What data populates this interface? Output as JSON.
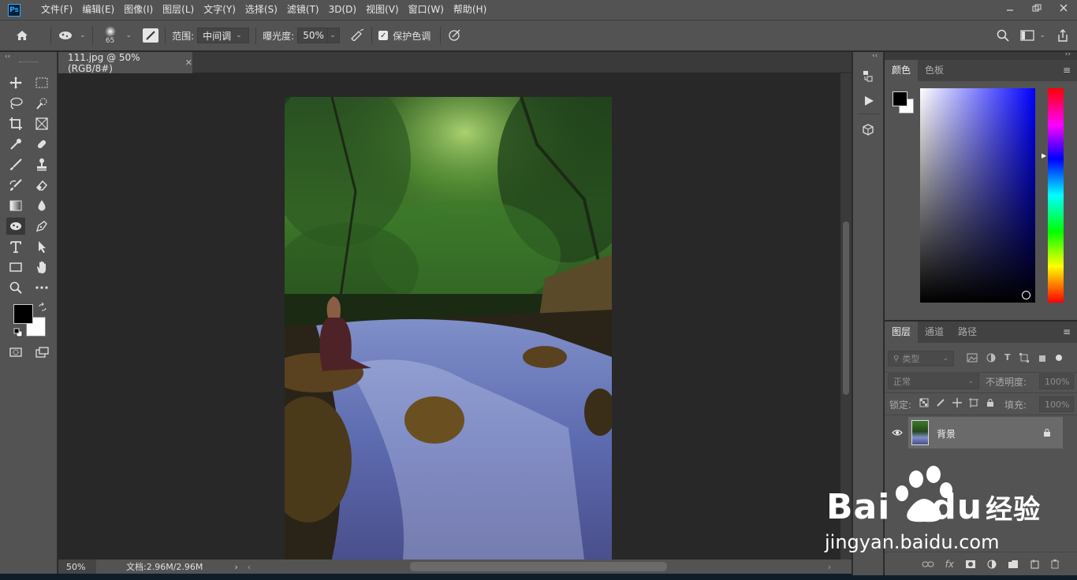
{
  "menu": {
    "logo": "Ps",
    "items": [
      "文件(F)",
      "编辑(E)",
      "图像(I)",
      "图层(L)",
      "文字(Y)",
      "选择(S)",
      "滤镜(T)",
      "3D(D)",
      "视图(V)",
      "窗口(W)",
      "帮助(H)"
    ]
  },
  "options": {
    "brush_size": "65",
    "range_label": "范围:",
    "range_value": "中间调",
    "exposure_label": "曝光度:",
    "exposure_value": "50%",
    "protect_label": "保护色调"
  },
  "document": {
    "tab_title": "111.jpg @ 50%(RGB/8#)",
    "zoom": "50%",
    "doc_size": "文档:2.96M/2.96M"
  },
  "color_panel": {
    "tabs": [
      "颜色",
      "色板"
    ]
  },
  "layers_panel": {
    "tabs": [
      "图层",
      "通道",
      "路径"
    ],
    "filter_placeholder": "类型",
    "blend_mode": "正常",
    "opacity_label": "不透明度:",
    "opacity_value": "100%",
    "lock_label": "锁定:",
    "fill_label": "填充:",
    "fill_value": "100%",
    "layers": [
      {
        "name": "背景"
      }
    ],
    "footer_fx": "fx"
  },
  "watermark": {
    "brand": "Bai",
    "brand2": "du",
    "brand_cn": "经验",
    "url": "jingyan.baidu.com"
  }
}
